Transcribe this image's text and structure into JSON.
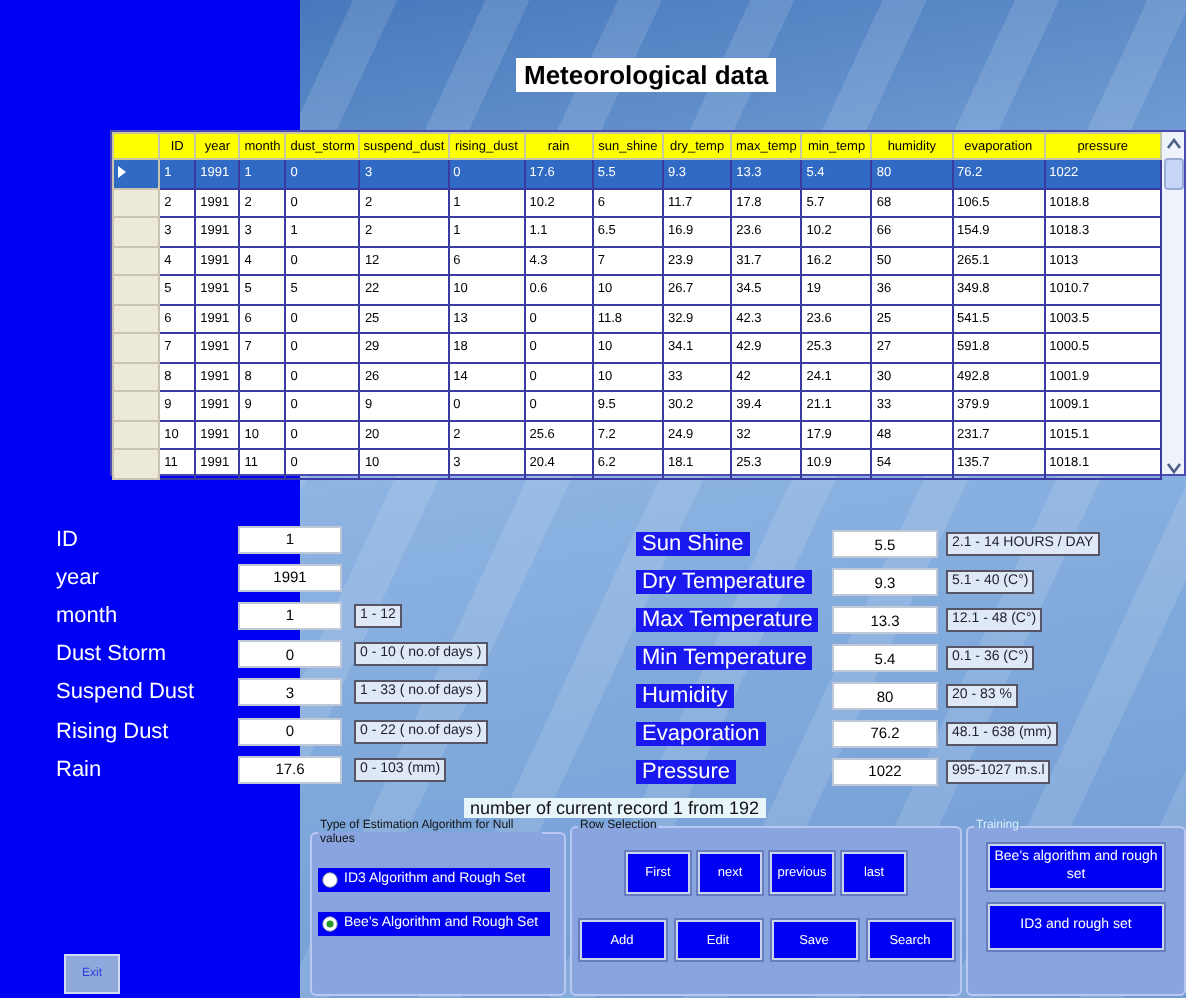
{
  "title": "Meteorological data",
  "table": {
    "columns": [
      "ID",
      "year",
      "month",
      "dust_storm",
      "suspend_dust",
      "rising_dust",
      "rain",
      "sun_shine",
      "dry_temp",
      "max_temp",
      "min_temp",
      "humidity",
      "evaporation",
      "pressure"
    ],
    "rows": [
      {
        "selected": true,
        "cells": [
          "1",
          "1991",
          "1",
          "0",
          "3",
          "0",
          "17.6",
          "5.5",
          "9.3",
          "13.3",
          "5.4",
          "80",
          "76.2",
          "1022"
        ]
      },
      {
        "selected": false,
        "cells": [
          "2",
          "1991",
          "2",
          "0",
          "2",
          "1",
          "10.2",
          "6",
          "11.7",
          "17.8",
          "5.7",
          "68",
          "106.5",
          "1018.8"
        ]
      },
      {
        "selected": false,
        "cells": [
          "3",
          "1991",
          "3",
          "1",
          "2",
          "1",
          "1.1",
          "6.5",
          "16.9",
          "23.6",
          "10.2",
          "66",
          "154.9",
          "1018.3"
        ]
      },
      {
        "selected": false,
        "cells": [
          "4",
          "1991",
          "4",
          "0",
          "12",
          "6",
          "4.3",
          "7",
          "23.9",
          "31.7",
          "16.2",
          "50",
          "265.1",
          "1013"
        ]
      },
      {
        "selected": false,
        "cells": [
          "5",
          "1991",
          "5",
          "5",
          "22",
          "10",
          "0.6",
          "10",
          "26.7",
          "34.5",
          "19",
          "36",
          "349.8",
          "1010.7"
        ]
      },
      {
        "selected": false,
        "cells": [
          "6",
          "1991",
          "6",
          "0",
          "25",
          "13",
          "0",
          "11.8",
          "32.9",
          "42.3",
          "23.6",
          "25",
          "541.5",
          "1003.5"
        ]
      },
      {
        "selected": false,
        "cells": [
          "7",
          "1991",
          "7",
          "0",
          "29",
          "18",
          "0",
          "10",
          "34.1",
          "42.9",
          "25.3",
          "27",
          "591.8",
          "1000.5"
        ]
      },
      {
        "selected": false,
        "cells": [
          "8",
          "1991",
          "8",
          "0",
          "26",
          "14",
          "0",
          "10",
          "33",
          "42",
          "24.1",
          "30",
          "492.8",
          "1001.9"
        ]
      },
      {
        "selected": false,
        "cells": [
          "9",
          "1991",
          "9",
          "0",
          "9",
          "0",
          "0",
          "9.5",
          "30.2",
          "39.4",
          "21.1",
          "33",
          "379.9",
          "1009.1"
        ]
      },
      {
        "selected": false,
        "cells": [
          "10",
          "1991",
          "10",
          "0",
          "20",
          "2",
          "25.6",
          "7.2",
          "24.9",
          "32",
          "17.9",
          "48",
          "231.7",
          "1015.1"
        ]
      },
      {
        "selected": false,
        "cells": [
          "11",
          "1991",
          "11",
          "0",
          "10",
          "3",
          "20.4",
          "6.2",
          "18.1",
          "25.3",
          "10.9",
          "54",
          "135.7",
          "1018.1"
        ]
      }
    ]
  },
  "left_fields": [
    {
      "label": "ID",
      "value": "1"
    },
    {
      "label": "year",
      "value": "1991"
    },
    {
      "label": "month",
      "value": "1",
      "hint": "1 - 12"
    },
    {
      "label": "Dust Storm",
      "value": "0",
      "hint": "0 - 10 ( no.of days )"
    },
    {
      "label": "Suspend Dust",
      "value": "3",
      "hint": "1 - 33 ( no.of days )"
    },
    {
      "label": "Rising Dust",
      "value": "0",
      "hint": "0 - 22 ( no.of days )"
    },
    {
      "label": "Rain",
      "value": "17.6",
      "hint": "0 - 103 (mm)"
    }
  ],
  "right_fields": [
    {
      "label": "Sun Shine",
      "value": "5.5",
      "hint": "2.1 - 14  HOURS / DAY"
    },
    {
      "label": "Dry Temperature",
      "value": "9.3",
      "hint": "5.1 - 40 (C°)"
    },
    {
      "label": "Max Temperature",
      "value": "13.3",
      "hint": "12.1 - 48 (C°)"
    },
    {
      "label": "Min Temperature",
      "value": "5.4",
      "hint": "0.1 - 36 (C°)"
    },
    {
      "label": "Humidity",
      "value": "80",
      "hint": "20 - 83 %"
    },
    {
      "label": "Evaporation",
      "value": "76.2",
      "hint": "48.1 - 638 (mm)"
    },
    {
      "label": "Pressure",
      "value": "1022",
      "hint": "995-1027 m.s.l"
    }
  ],
  "record_status": "number of current record  1 from 192",
  "exit_button": "Exit",
  "estimation": {
    "title": "Type of Estimation Algorithm for Null values",
    "options": [
      {
        "label": "ID3 Algorithm and Rough Set",
        "selected": false
      },
      {
        "label": "Bee's Algorithm and Rough Set",
        "selected": true
      }
    ]
  },
  "row_selection": {
    "title": "Row Selection",
    "navigation": [
      "First",
      "next",
      "previous",
      "last"
    ],
    "actions": [
      "Add",
      "Edit",
      "Save",
      "Search"
    ]
  },
  "training": {
    "title": "Training",
    "buttons": [
      "Bee's algorithm and rough set",
      "ID3 and rough set"
    ]
  }
}
